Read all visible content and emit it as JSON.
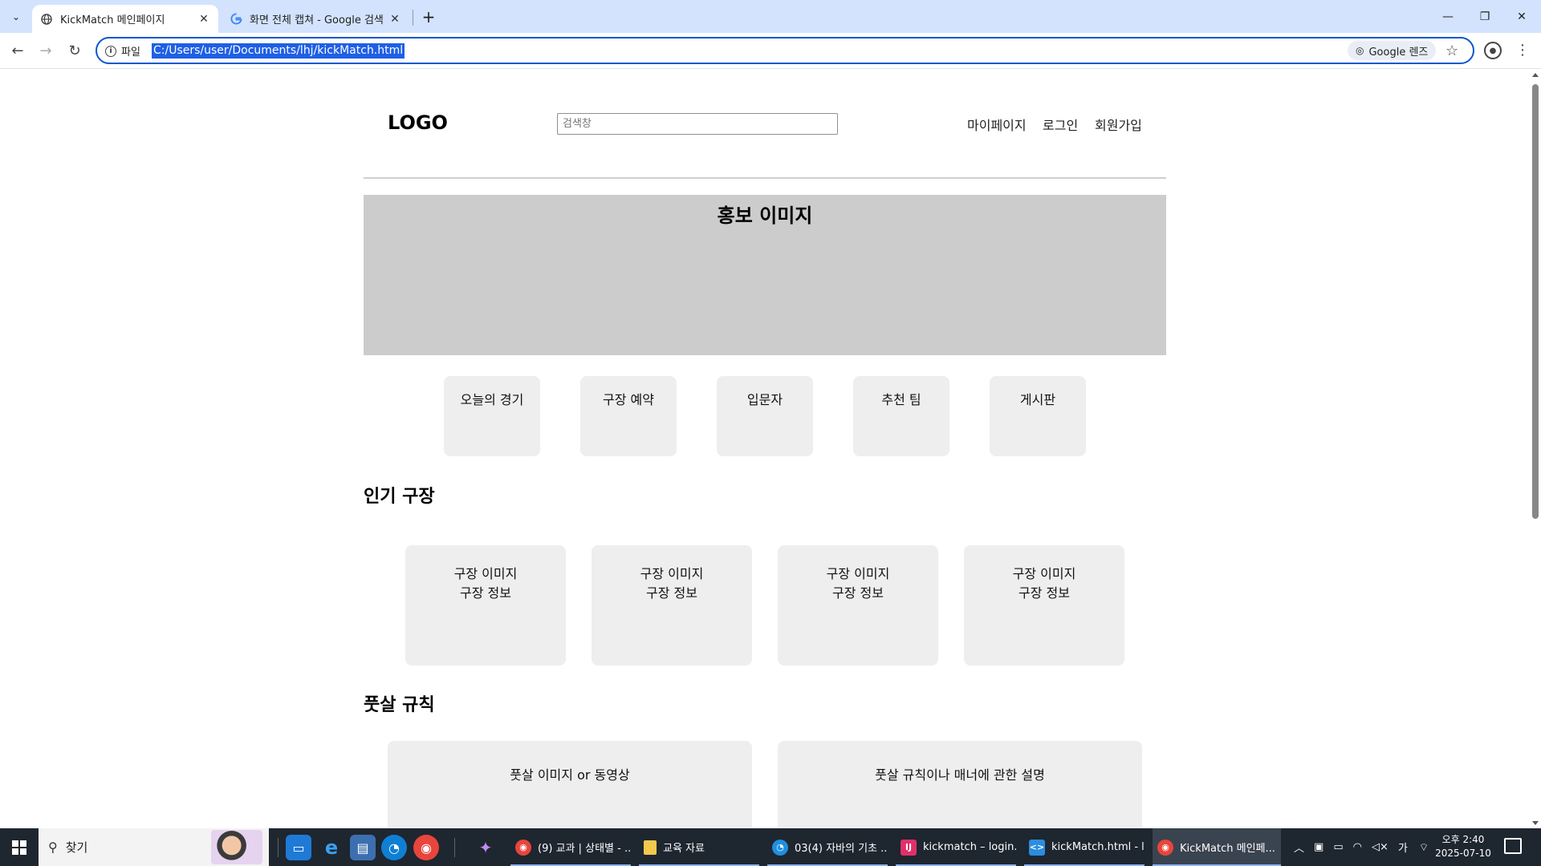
{
  "browser": {
    "tabs": [
      {
        "title": "KickMatch 메인페이지",
        "active": true
      },
      {
        "title": "화면 전체 캡쳐 - Google 검색",
        "active": false
      }
    ],
    "address": {
      "security_label": "파일",
      "url": "C:/Users/user/Documents/lhj/kickMatch.html"
    },
    "lens_label": "Google 렌즈"
  },
  "site": {
    "logo": "LOGO",
    "search_placeholder": "검색창",
    "nav": [
      "마이페이지",
      "로그인",
      "회원가입"
    ],
    "promo_title": "홍보 이미지",
    "quick_links": [
      "오늘의 경기",
      "구장 예약",
      "입문자",
      "추천 팀",
      "게시판"
    ],
    "popular_title": "인기 구장",
    "field_cards": [
      {
        "image": "구장 이미지",
        "info": "구장 정보"
      },
      {
        "image": "구장 이미지",
        "info": "구장 정보"
      },
      {
        "image": "구장 이미지",
        "info": "구장 정보"
      },
      {
        "image": "구장 이미지",
        "info": "구장 정보"
      }
    ],
    "rules_title": "풋살 규칙",
    "rule_cards": [
      "풋살 이미지 or 동영상",
      "풋살 규칙이나 매너에 관한 설명"
    ]
  },
  "taskbar": {
    "search_text": "찾기",
    "apps": [
      {
        "label": "(9) 교과 | 상태별 - ...",
        "icon": "chrome-icon",
        "color": "#e8453c"
      },
      {
        "label": "교육 자료",
        "icon": "folder-icon",
        "color": "#f2c94c"
      },
      {
        "label": "03(4) 자바의 기초 ...",
        "icon": "edge-icon",
        "color": "#1f8fe0"
      },
      {
        "label": "kickmatch – login....",
        "icon": "intellij-icon",
        "color": "#e0306b"
      },
      {
        "label": "kickMatch.html - l...",
        "icon": "vscode-icon",
        "color": "#2a8de0"
      },
      {
        "label": "KickMatch 메인페...",
        "icon": "chrome-icon",
        "color": "#e8453c"
      }
    ],
    "ime": "가",
    "time": "오후 2:40",
    "date": "2025-07-10"
  }
}
